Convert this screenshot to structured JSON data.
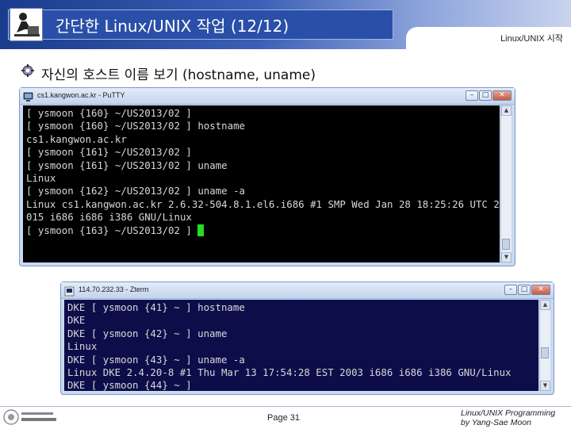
{
  "header": {
    "title": "간단한 Linux/UNIX 작업 (12/12)",
    "section_label": "Linux/UNIX 시작"
  },
  "bullet": {
    "text": "자신의 호스트 이름 보기 (hostname, uname)"
  },
  "window1": {
    "title": "cs1.kangwon.ac.kr - PuTTY",
    "lines": [
      "[ ysmoon {160} ~/US2013/02 ]",
      "[ ysmoon {160} ~/US2013/02 ] hostname",
      "cs1.kangwon.ac.kr",
      "[ ysmoon {161} ~/US2013/02 ]",
      "[ ysmoon {161} ~/US2013/02 ] uname",
      "Linux",
      "[ ysmoon {162} ~/US2013/02 ] uname -a",
      "Linux cs1.kangwon.ac.kr 2.6.32-504.8.1.el6.i686 #1 SMP Wed Jan 28 18:25:26 UTC 2",
      "015 i686 i686 i386 GNU/Linux",
      "[ ysmoon {163} ~/US2013/02 ] "
    ]
  },
  "window2": {
    "title": "114.70.232.33 - Zterm",
    "lines": [
      "DKE [ ysmoon {41} ~ ] hostname",
      "DKE",
      "DKE [ ysmoon {42} ~ ] uname",
      "Linux",
      "DKE [ ysmoon {43} ~ ] uname -a",
      "Linux DKE 2.4.20-8 #1 Thu Mar 13 17:54:28 EST 2003 i686 i686 i386 GNU/Linux",
      "DKE [ ysmoon {44} ~ ]"
    ]
  },
  "window_controls": {
    "minimize": "–",
    "maximize": "□",
    "close": "✕"
  },
  "footer": {
    "page": "Page 31",
    "credit_line1": "Linux/UNIX Programming",
    "credit_line2": "by Yang-Sae Moon"
  },
  "colors": {
    "header_dark": "#1a3c8c",
    "terminal1_bg": "#000000",
    "terminal2_bg": "#0d0d4a",
    "cursor": "#22dd22"
  }
}
